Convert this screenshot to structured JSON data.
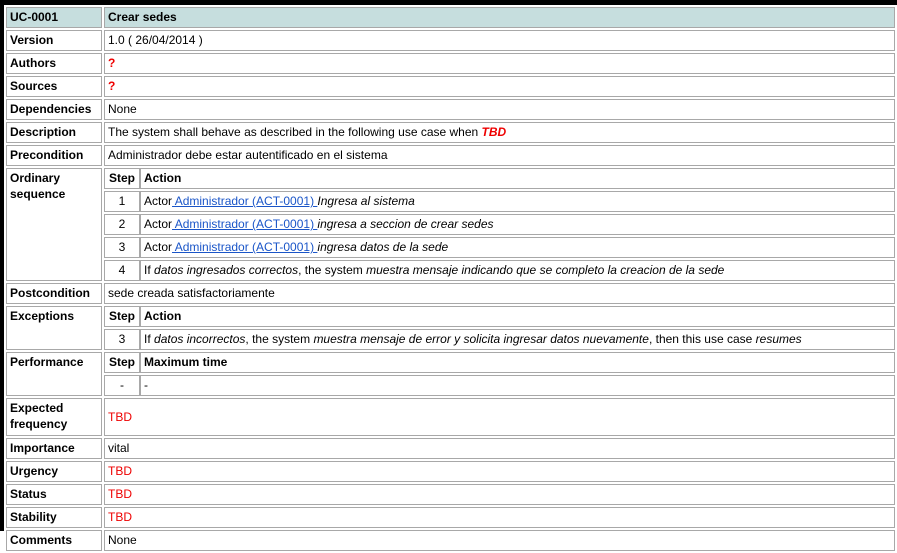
{
  "header": {
    "id": "UC-0001",
    "title": "Crear sedes"
  },
  "rows": {
    "version": {
      "label": "Version",
      "value": "1.0 ( 26/04/2014 )"
    },
    "authors": {
      "label": "Authors",
      "value": "?"
    },
    "sources": {
      "label": "Sources",
      "value": "?"
    },
    "dependencies": {
      "label": "Dependencies",
      "value": "None"
    },
    "description": {
      "label": "Description",
      "text": "The system shall behave as described in the following use case when ",
      "tbd": "TBD"
    },
    "precondition": {
      "label": "Precondition",
      "value": "Administrador debe estar autentificado en el sistema"
    },
    "postcondition": {
      "label": "Postcondition",
      "value": "sede creada satisfactoriamente"
    },
    "expected_frequency": {
      "label": "Expected frequency",
      "value": "TBD"
    },
    "importance": {
      "label": "Importance",
      "value": "vital"
    },
    "urgency": {
      "label": "Urgency",
      "value": "TBD"
    },
    "status": {
      "label": "Status",
      "value": "TBD"
    },
    "stability": {
      "label": "Stability",
      "value": "TBD"
    },
    "comments": {
      "label": "Comments",
      "value": "None"
    }
  },
  "ordinary": {
    "label": "Ordinary sequence",
    "step_header": "Step",
    "action_header": "Action",
    "steps": [
      {
        "n": "1",
        "prefix": "Actor",
        "link": " Administrador (ACT-0001) ",
        "action": "Ingresa al sistema"
      },
      {
        "n": "2",
        "prefix": "Actor",
        "link": " Administrador (ACT-0001) ",
        "action": "ingresa a seccion de crear sedes"
      },
      {
        "n": "3",
        "prefix": "Actor",
        "link": " Administrador (ACT-0001) ",
        "action": "ingresa datos de la sede"
      }
    ],
    "step4": {
      "n": "4",
      "if": "If ",
      "cond": "datos ingresados correctos",
      "mid": ", the system ",
      "act": "muestra mensaje indicando que se completo la creacion de la sede"
    }
  },
  "exceptions": {
    "label": "Exceptions",
    "step_header": "Step",
    "action_header": "Action",
    "step": {
      "n": "3",
      "if": "If ",
      "cond": "datos incorrectos",
      "mid": ", the system ",
      "act": "muestra mensaje de error y solicita ingresar datos nuevamente",
      "then": ", then this use case ",
      "res": "resumes"
    }
  },
  "performance": {
    "label": "Performance",
    "step_header": "Step",
    "time_header": "Maximum time",
    "step": "-",
    "time": "-"
  }
}
